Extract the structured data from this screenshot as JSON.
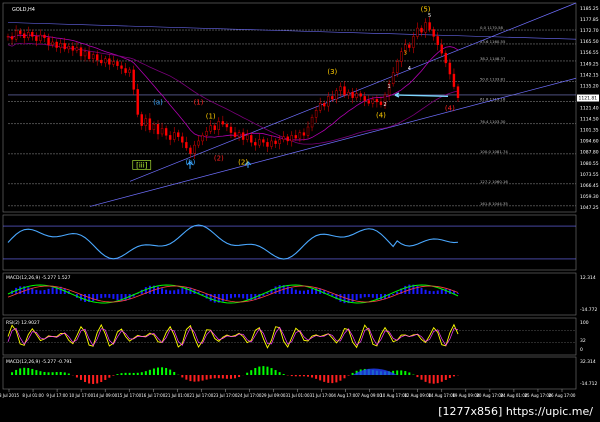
{
  "watermark": "[1277x856] https://upic.me/",
  "symbol": "GOLD,H4",
  "colors": {
    "bg": "#000000",
    "grid": "#333333",
    "candle": "#ff0000",
    "ma": "#b000b0",
    "channel": "#6f6fff",
    "fib": "#bbbbbb",
    "wave_cyan": "#3aa6ff",
    "wave_red": "#ff2020",
    "wave_yellow": "#ffcc00",
    "wave_white": "#ffffff",
    "green": "#00ff00",
    "blue_fill": "#1a1aff"
  },
  "chart_data": [
    {
      "type": "candlestick",
      "title": "GOLD,H4",
      "ylim": [
        1040,
        1190
      ],
      "y_ticks": [
        "1185.25",
        "1177.85",
        "1172.70",
        "1165.50",
        "1156.55",
        "1149.25",
        "1142.15",
        "1135.20",
        "1128.30",
        "1121.40",
        "1114.50",
        "1101.35",
        "1094.60",
        "1087.80",
        "1080.55",
        "1073.55",
        "1066.45",
        "1059.30",
        "1047.25"
      ],
      "x_ticks": [
        "3 Jul 2015",
        "8 Jul 01:00",
        "9 Jul 17:00",
        "10 Jul 17:00",
        "14 Jul 09:00",
        "15 Jul 17:00",
        "16 Jul 17:00",
        "21 Jul 01:00",
        "21 Jul 17:00",
        "23 Jul 17:00",
        "24 Jul 17:00",
        "29 Jul 09:00",
        "31 Jul 01:00",
        "31 Jul 17:00",
        "4 Aug 17:00",
        "7 Aug 09:00",
        "10 Aug 17:00",
        "12 Aug 09:00",
        "14 Aug 17:00",
        "19 Aug 09:00",
        "20 Aug 17:00",
        "24 Aug 01:00",
        "25 Aug 17:00",
        "26 Aug 17:00"
      ],
      "price_marker": "1121.81",
      "closes": [
        1166,
        1164,
        1170,
        1168,
        1165,
        1169,
        1166,
        1163,
        1167,
        1165,
        1160,
        1162,
        1158,
        1161,
        1157,
        1159,
        1156,
        1158,
        1152,
        1155,
        1150,
        1153,
        1149,
        1147,
        1150,
        1146,
        1148,
        1145,
        1143,
        1140,
        1142,
        1128,
        1110,
        1102,
        1107,
        1099,
        1103,
        1096,
        1100,
        1095,
        1092,
        1097,
        1094,
        1090,
        1086,
        1082,
        1088,
        1091,
        1095,
        1098,
        1102,
        1099,
        1105,
        1103,
        1101,
        1097,
        1094,
        1097,
        1092,
        1095,
        1090,
        1088,
        1092,
        1090,
        1087,
        1091,
        1089,
        1092,
        1094,
        1091,
        1095,
        1093,
        1097,
        1095,
        1101,
        1108,
        1113,
        1118,
        1116,
        1123,
        1121,
        1127,
        1130,
        1124,
        1126,
        1122,
        1125,
        1123,
        1120,
        1118,
        1121,
        1119,
        1117,
        1124,
        1132,
        1140,
        1148,
        1155,
        1160,
        1158,
        1166,
        1172,
        1169,
        1176,
        1171,
        1166,
        1160,
        1154,
        1147,
        1139,
        1130,
        1122
      ],
      "fib_levels": [
        {
          "label": "0.0  1170.58",
          "value": 1170.6
        },
        {
          "label": "23.6  1160.55",
          "value": 1160.6
        },
        {
          "label": "38.2  1148.37",
          "value": 1148.4
        },
        {
          "label": "50.0  1133.81",
          "value": 1133.8
        },
        {
          "label": "61.8  1119.18",
          "value": 1119.2
        },
        {
          "label": "76.4  1103.30",
          "value": 1103.3
        },
        {
          "label": "100.0  1081.74",
          "value": 1081.7
        },
        {
          "label": "127.2  1060.16",
          "value": 1060.2
        },
        {
          "label": "161.8  1044.35",
          "value": 1044.4
        }
      ],
      "wave_labels": [
        {
          "text": "[iii]",
          "color": "#bdfc3a",
          "boxed": true,
          "i": 33,
          "price": 1072
        },
        {
          "text": "(a)",
          "color": "#3aa6ff",
          "i": 37,
          "price": 1117
        },
        {
          "text": "(b)",
          "color": "#3aa6ff",
          "i": 45,
          "price": 1074
        },
        {
          "text": "(1)",
          "color": "#ff2020",
          "i": 47,
          "price": 1117
        },
        {
          "text": "(2)",
          "color": "#ff2020",
          "i": 52,
          "price": 1077
        },
        {
          "text": "(1)",
          "color": "#ffcc00",
          "i": 50,
          "price": 1107
        },
        {
          "text": "(2)",
          "color": "#ffcc00",
          "i": 58,
          "price": 1074
        },
        {
          "text": "(3)",
          "color": "#ffcc00",
          "i": 80,
          "price": 1139
        },
        {
          "text": "(4)",
          "color": "#ffcc00",
          "i": 92,
          "price": 1108
        },
        {
          "text": "(5)",
          "color": "#ffcc00",
          "i": 103,
          "price": 1184
        },
        {
          "text": "(3)",
          "color": "#ff2020",
          "i": 104,
          "price": 1199
        },
        {
          "text": "(4)",
          "color": "#ff2020",
          "i": 109,
          "price": 1113
        },
        {
          "text": "1",
          "color": "#ffffff",
          "i": 94,
          "price": 1129
        },
        {
          "text": "2",
          "color": "#ffffff",
          "i": 93,
          "price": 1116
        },
        {
          "text": "3",
          "color": "#ffcc00",
          "i": 98,
          "price": 1153
        },
        {
          "text": "4",
          "color": "#ffffff",
          "i": 99,
          "price": 1142
        },
        {
          "text": "5",
          "color": "#ffffff",
          "i": 104,
          "price": 1180
        }
      ]
    },
    {
      "type": "line",
      "title": "",
      "y_ticks": [],
      "series": []
    },
    {
      "type": "bar",
      "title": "MACD(12,26,9) -5.277 1.527",
      "y_ticks": [
        "12.314",
        "",
        "-14.772"
      ]
    },
    {
      "type": "line",
      "title": "RSI(2) 12.9027",
      "y_ticks": [
        "100",
        "",
        "32",
        "0"
      ]
    },
    {
      "type": "bar",
      "title": "MACD(12,26,9) -5.277 -0.791",
      "y_ticks": [
        "32.314",
        "",
        "-14.712"
      ]
    }
  ]
}
